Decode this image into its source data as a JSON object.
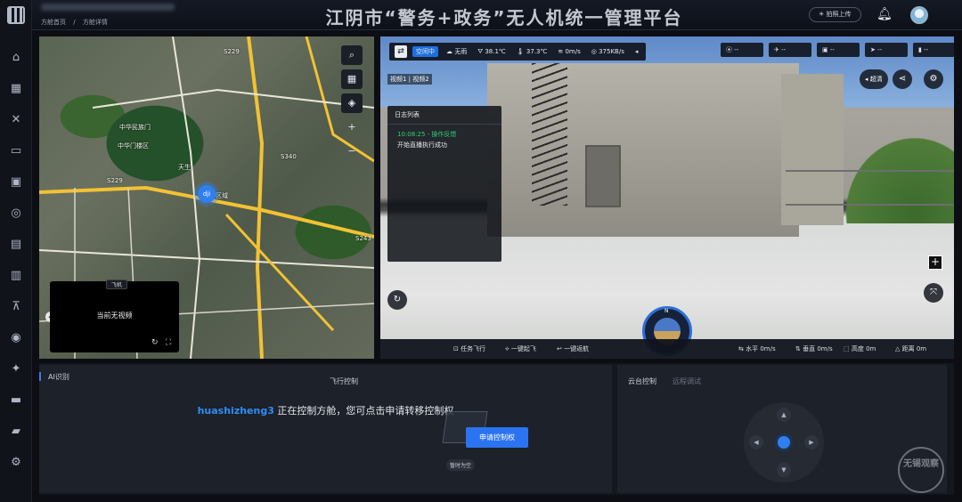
{
  "header": {
    "title": "江阴市“警务+政务”无人机统一管理平台",
    "crumbs": [
      "方舱首页",
      "/",
      "方舱详情"
    ],
    "action_button": "拍照上传",
    "bell_icon": "bell-icon",
    "avatar_icon": "user-avatar"
  },
  "rail": {
    "items": [
      "home-icon",
      "map-icon",
      "drone-icon",
      "dock-icon",
      "apps-icon",
      "route-icon",
      "media-icon",
      "building-icon",
      "signal-tower-icon",
      "globe-icon",
      "ai-icon",
      "server-icon",
      "folder-icon",
      "gear-icon"
    ]
  },
  "map": {
    "labels": [
      "中华民族门",
      "中华门楼区",
      "天生",
      "区域",
      "S340",
      "S229",
      "S243",
      "S229"
    ],
    "pin_label": "dji",
    "pip": {
      "tag": "飞机",
      "message": "当前无视频"
    }
  },
  "video": {
    "status": "空闲中",
    "weather": "无雨",
    "temp1": "38.1℃",
    "temp2": "37.3℃",
    "wind": "0m/s",
    "network": "375KB/s",
    "right_chips": [
      "--",
      "--",
      "--",
      "--",
      "--"
    ],
    "tabs": "视频1 | 视频2",
    "log": {
      "title": "日志列表",
      "time_line": "10:08:25 - 操作反馈",
      "message": "开始直播执行成功"
    },
    "quality_pill": "超清",
    "bottom": {
      "task_flight": "任务飞行",
      "takeoff": "一键起飞",
      "return": "一键返航",
      "h_speed": "水平 0m/s",
      "v_speed": "垂直 0m/s",
      "altitude": "高度 0m",
      "distance": "距离 0m"
    }
  },
  "panel": {
    "ai_title": "AI识别",
    "flight_title": "飞行控制",
    "gimbal_title": "云台控制",
    "remote_title": "远程调试",
    "ctrl_user": "huashizheng3",
    "ctrl_msg": " 正在控制方舱，您可点击申请转移控制权",
    "request_button": "申请控制权",
    "empty_note": "暂时为空",
    "watermark": "无锡观察"
  }
}
